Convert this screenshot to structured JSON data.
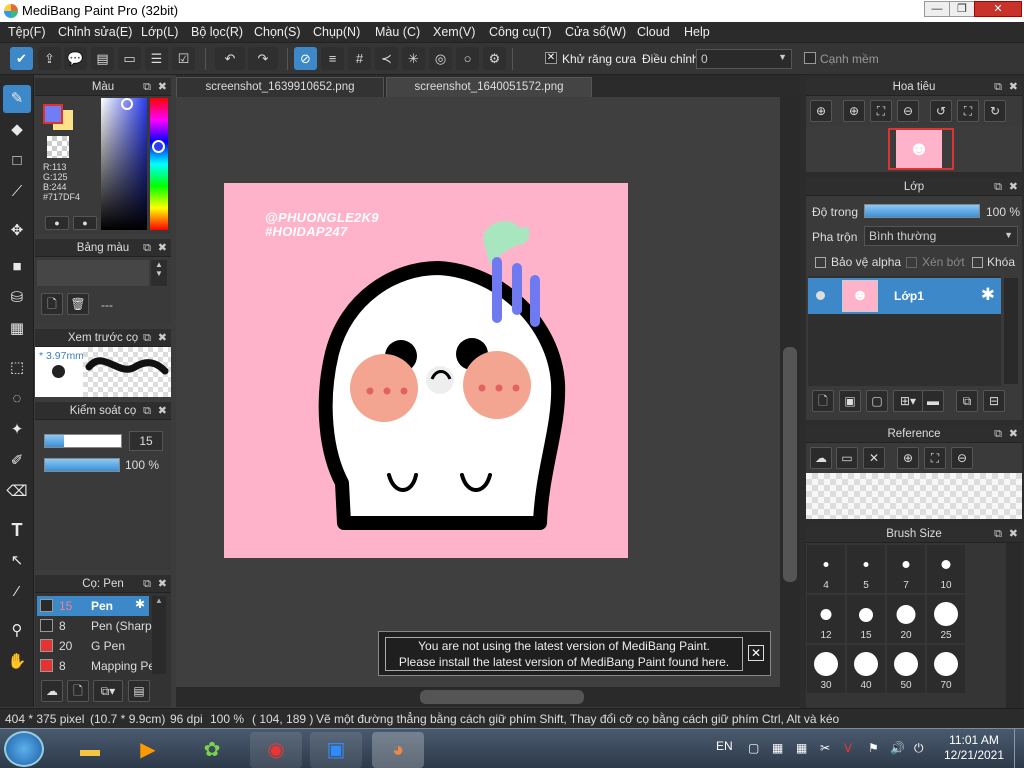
{
  "window": {
    "title": "MediBang Paint Pro (32bit)",
    "minimize": "—",
    "restore": "❐",
    "close": "✕"
  },
  "menu": [
    "Tệp(F)",
    "Chỉnh sửa(E)",
    "Lớp(L)",
    "Bộ lọc(R)",
    "Chọn(S)",
    "Chụp(N)",
    "Màu (C)",
    "Xem(V)",
    "Công cụ(T)",
    "Cửa sổ(W)",
    "Cloud",
    "Help"
  ],
  "toolbar": {
    "antialias_label": "Khử răng cưa",
    "antialias_checked": true,
    "adjust_label": "Điều chỉnh",
    "adjust_value": "0",
    "soft_edge_label": "Cạnh mềm",
    "soft_edge_checked": false
  },
  "color_panel": {
    "title": "Màu",
    "r": "R:113",
    "g": "G:125",
    "b": "B:244",
    "hex": "#717DF4",
    "foreground": "#717df4",
    "background": "#fce08a"
  },
  "palette_panel": {
    "title": "Bảng màu",
    "placeholder": "---"
  },
  "brush_preview_panel": {
    "title": "Xem trước cọ",
    "size": "* 3.97mm"
  },
  "brush_control_panel": {
    "title": "Kiểm soát cọ",
    "size": "15",
    "opacity": "100 %",
    "size_fraction": 0.25,
    "opacity_fraction": 1.0
  },
  "brush_list_panel": {
    "title": "Cọ: Pen",
    "items": [
      {
        "size": "15",
        "name": "Pen",
        "color": "#2a2a2a",
        "selected": true
      },
      {
        "size": "8",
        "name": "Pen (Sharp)",
        "color": "#2a2a2a",
        "selected": false
      },
      {
        "size": "20",
        "name": "G Pen",
        "color": "#e33333",
        "selected": false
      },
      {
        "size": "8",
        "name": "Mapping Pen",
        "color": "#e33333",
        "selected": false
      }
    ]
  },
  "tabs": [
    "screenshot_1639910652.png",
    "screenshot_1640051572.png"
  ],
  "artwork": {
    "line1": "@PHUONGLE2K9",
    "line2": "#HOIDAP247"
  },
  "navigator_panel": {
    "title": "Hoa tiêu"
  },
  "layer_panel": {
    "title": "Lớp",
    "opacity_label": "Độ trong",
    "opacity_value": "100 %",
    "opacity_fraction": 1.0,
    "blend_label": "Pha trộn",
    "blend_value": "Bình thường",
    "protect_alpha": "Bảo vệ alpha",
    "clipping": "Xén bớt",
    "lock": "Khóa",
    "layers": [
      {
        "name": "Lớp1"
      }
    ]
  },
  "reference_panel": {
    "title": "Reference"
  },
  "brush_size_panel": {
    "title": "Brush Size",
    "sizes": [
      "4",
      "5",
      "7",
      "10",
      "12",
      "15",
      "20",
      "25",
      "30",
      "40",
      "50",
      "70"
    ]
  },
  "notification": {
    "line1": "You are not using the latest version of MediBang Paint.",
    "line2": "Please install the latest version of MediBang Paint found here."
  },
  "statusbar": {
    "size": "404 * 375 pixel",
    "cm": "(10.7 * 9.9cm)",
    "dpi": "96 dpi",
    "zoom": "100 %",
    "coords": "( 104, 189 )",
    "hint": "Vẽ một đường thẳng bằng cách giữ phím Shift, Thay đổi cỡ cọ bằng cách giữ phím Ctrl, Alt và kéo"
  },
  "taskbar": {
    "lang": "EN",
    "time": "11:01 AM",
    "date": "12/21/2021"
  }
}
